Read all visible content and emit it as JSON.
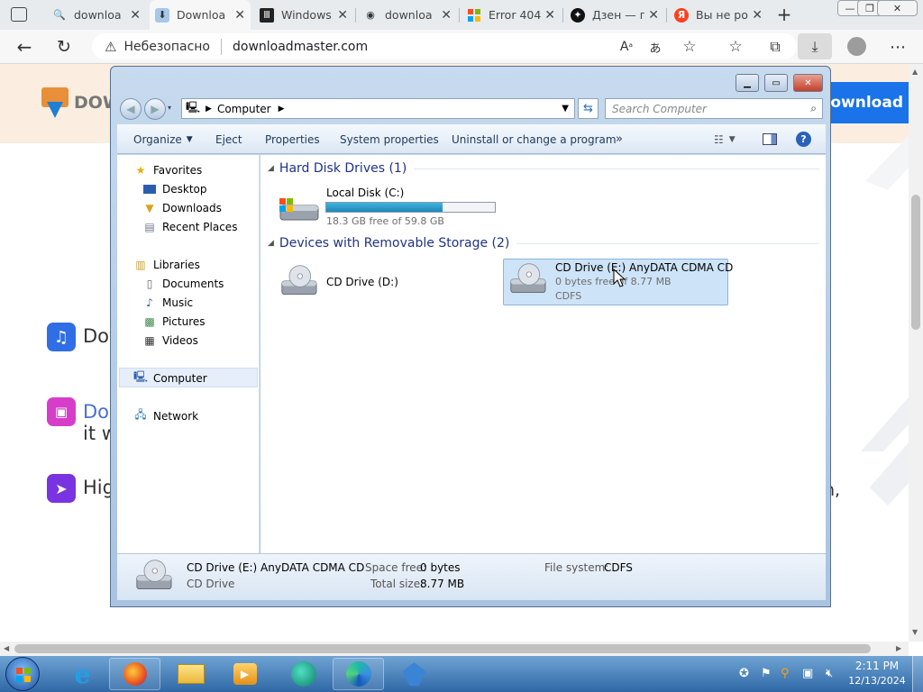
{
  "browser": {
    "tabs": [
      {
        "label": "downloa",
        "icon": "search-icon"
      },
      {
        "label": "Downloa",
        "icon": "shield-icon",
        "active": true
      },
      {
        "label": "Windows",
        "icon": "book-icon"
      },
      {
        "label": "downloa",
        "icon": "github-icon"
      },
      {
        "label": "Error 404",
        "icon": "microsoft-icon"
      },
      {
        "label": "Дзен — г",
        "icon": "zen-icon"
      },
      {
        "label": "Вы не ро",
        "icon": "yandex-icon"
      }
    ],
    "new_tab": "+",
    "window_controls": {
      "minimize": "—",
      "restore": "❐",
      "close": "✕"
    },
    "security_label": "Небезопасно",
    "url": "downloadmaster.com",
    "accent": "#1a73e8"
  },
  "site": {
    "logo_text": "DOW",
    "download_button": "Download",
    "features": [
      {
        "text": "Dov",
        "icon_color": "#2f6ee5"
      },
      {
        "text": "Dov",
        "text2": "it w",
        "icon_color": "#d63ec9"
      },
      {
        "text": "Hig",
        "icon_color": "#7a33e0"
      }
    ],
    "trailing_text": "n,"
  },
  "explorer": {
    "breadcrumb": "Computer",
    "search_placeholder": "Search Computer",
    "toolbar": {
      "organize": "Organize",
      "eject": "Eject",
      "properties": "Properties",
      "system_properties": "System properties",
      "uninstall": "Uninstall or change a program",
      "more": "»"
    },
    "sidebar": {
      "favorites": "Favorites",
      "desktop": "Desktop",
      "downloads": "Downloads",
      "recent": "Recent Places",
      "libraries": "Libraries",
      "documents": "Documents",
      "music": "Music",
      "pictures": "Pictures",
      "videos": "Videos",
      "computer": "Computer",
      "network": "Network"
    },
    "groups": {
      "hdd": "Hard Disk Drives (1)",
      "removable": "Devices with Removable Storage (2)"
    },
    "local_disk": {
      "name": "Local Disk (C:)",
      "free": "18.3 GB free of 59.8 GB",
      "used_fraction": 0.69
    },
    "cd_d": {
      "name": "CD Drive (D:)"
    },
    "cd_e": {
      "name": "CD Drive (E:) AnyDATA CDMA CD",
      "free": "0 bytes free of 8.77 MB",
      "fs": "CDFS"
    },
    "status": {
      "name": "CD Drive (E:) AnyDATA CDMA CD",
      "type": "CD Drive",
      "space_free_label": "Space free:",
      "space_free": "0 bytes",
      "total_label": "Total size:",
      "total": "8.77 MB",
      "fs_label": "File system:",
      "fs": "CDFS"
    }
  },
  "taskbar": {
    "time": "2:11 PM",
    "date": "12/13/2024"
  }
}
